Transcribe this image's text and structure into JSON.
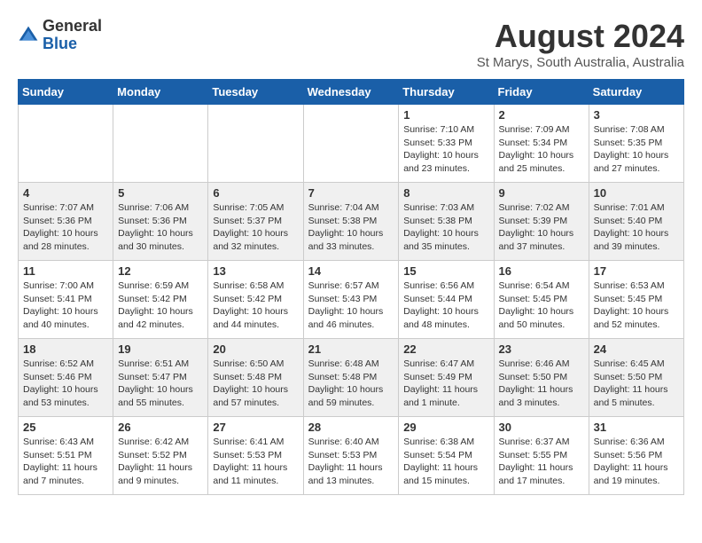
{
  "header": {
    "logo_general": "General",
    "logo_blue": "Blue",
    "month_year": "August 2024",
    "location": "St Marys, South Australia, Australia"
  },
  "weekdays": [
    "Sunday",
    "Monday",
    "Tuesday",
    "Wednesday",
    "Thursday",
    "Friday",
    "Saturday"
  ],
  "weeks": [
    [
      {
        "day": "",
        "info": ""
      },
      {
        "day": "",
        "info": ""
      },
      {
        "day": "",
        "info": ""
      },
      {
        "day": "",
        "info": ""
      },
      {
        "day": "1",
        "info": "Sunrise: 7:10 AM\nSunset: 5:33 PM\nDaylight: 10 hours\nand 23 minutes."
      },
      {
        "day": "2",
        "info": "Sunrise: 7:09 AM\nSunset: 5:34 PM\nDaylight: 10 hours\nand 25 minutes."
      },
      {
        "day": "3",
        "info": "Sunrise: 7:08 AM\nSunset: 5:35 PM\nDaylight: 10 hours\nand 27 minutes."
      }
    ],
    [
      {
        "day": "4",
        "info": "Sunrise: 7:07 AM\nSunset: 5:36 PM\nDaylight: 10 hours\nand 28 minutes."
      },
      {
        "day": "5",
        "info": "Sunrise: 7:06 AM\nSunset: 5:36 PM\nDaylight: 10 hours\nand 30 minutes."
      },
      {
        "day": "6",
        "info": "Sunrise: 7:05 AM\nSunset: 5:37 PM\nDaylight: 10 hours\nand 32 minutes."
      },
      {
        "day": "7",
        "info": "Sunrise: 7:04 AM\nSunset: 5:38 PM\nDaylight: 10 hours\nand 33 minutes."
      },
      {
        "day": "8",
        "info": "Sunrise: 7:03 AM\nSunset: 5:38 PM\nDaylight: 10 hours\nand 35 minutes."
      },
      {
        "day": "9",
        "info": "Sunrise: 7:02 AM\nSunset: 5:39 PM\nDaylight: 10 hours\nand 37 minutes."
      },
      {
        "day": "10",
        "info": "Sunrise: 7:01 AM\nSunset: 5:40 PM\nDaylight: 10 hours\nand 39 minutes."
      }
    ],
    [
      {
        "day": "11",
        "info": "Sunrise: 7:00 AM\nSunset: 5:41 PM\nDaylight: 10 hours\nand 40 minutes."
      },
      {
        "day": "12",
        "info": "Sunrise: 6:59 AM\nSunset: 5:42 PM\nDaylight: 10 hours\nand 42 minutes."
      },
      {
        "day": "13",
        "info": "Sunrise: 6:58 AM\nSunset: 5:42 PM\nDaylight: 10 hours\nand 44 minutes."
      },
      {
        "day": "14",
        "info": "Sunrise: 6:57 AM\nSunset: 5:43 PM\nDaylight: 10 hours\nand 46 minutes."
      },
      {
        "day": "15",
        "info": "Sunrise: 6:56 AM\nSunset: 5:44 PM\nDaylight: 10 hours\nand 48 minutes."
      },
      {
        "day": "16",
        "info": "Sunrise: 6:54 AM\nSunset: 5:45 PM\nDaylight: 10 hours\nand 50 minutes."
      },
      {
        "day": "17",
        "info": "Sunrise: 6:53 AM\nSunset: 5:45 PM\nDaylight: 10 hours\nand 52 minutes."
      }
    ],
    [
      {
        "day": "18",
        "info": "Sunrise: 6:52 AM\nSunset: 5:46 PM\nDaylight: 10 hours\nand 53 minutes."
      },
      {
        "day": "19",
        "info": "Sunrise: 6:51 AM\nSunset: 5:47 PM\nDaylight: 10 hours\nand 55 minutes."
      },
      {
        "day": "20",
        "info": "Sunrise: 6:50 AM\nSunset: 5:48 PM\nDaylight: 10 hours\nand 57 minutes."
      },
      {
        "day": "21",
        "info": "Sunrise: 6:48 AM\nSunset: 5:48 PM\nDaylight: 10 hours\nand 59 minutes."
      },
      {
        "day": "22",
        "info": "Sunrise: 6:47 AM\nSunset: 5:49 PM\nDaylight: 11 hours\nand 1 minute."
      },
      {
        "day": "23",
        "info": "Sunrise: 6:46 AM\nSunset: 5:50 PM\nDaylight: 11 hours\nand 3 minutes."
      },
      {
        "day": "24",
        "info": "Sunrise: 6:45 AM\nSunset: 5:50 PM\nDaylight: 11 hours\nand 5 minutes."
      }
    ],
    [
      {
        "day": "25",
        "info": "Sunrise: 6:43 AM\nSunset: 5:51 PM\nDaylight: 11 hours\nand 7 minutes."
      },
      {
        "day": "26",
        "info": "Sunrise: 6:42 AM\nSunset: 5:52 PM\nDaylight: 11 hours\nand 9 minutes."
      },
      {
        "day": "27",
        "info": "Sunrise: 6:41 AM\nSunset: 5:53 PM\nDaylight: 11 hours\nand 11 minutes."
      },
      {
        "day": "28",
        "info": "Sunrise: 6:40 AM\nSunset: 5:53 PM\nDaylight: 11 hours\nand 13 minutes."
      },
      {
        "day": "29",
        "info": "Sunrise: 6:38 AM\nSunset: 5:54 PM\nDaylight: 11 hours\nand 15 minutes."
      },
      {
        "day": "30",
        "info": "Sunrise: 6:37 AM\nSunset: 5:55 PM\nDaylight: 11 hours\nand 17 minutes."
      },
      {
        "day": "31",
        "info": "Sunrise: 6:36 AM\nSunset: 5:56 PM\nDaylight: 11 hours\nand 19 minutes."
      }
    ]
  ]
}
